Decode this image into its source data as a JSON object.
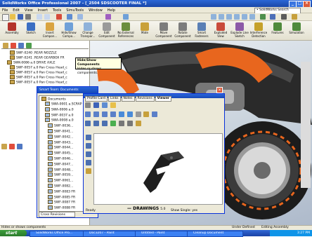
{
  "titlebar": {
    "title": "SolidWorks Office Professional 2007 - [_2504 SDSCOOTER FINAL *]"
  },
  "menu": {
    "items": [
      "File",
      "Edit",
      "View",
      "Insert",
      "Tools",
      "SimuTools",
      "Window",
      "Help"
    ],
    "search_placeholder": "• SolidWorks Search"
  },
  "commands": [
    {
      "label": "Assembly",
      "color": "#b3342c"
    },
    {
      "label": "Sketch",
      "color": "#3c6fc3"
    },
    {
      "label": "Insert Compon...",
      "color": "#d9a441"
    },
    {
      "label": "Hide/Show Compo...",
      "color": "#6fa0d8"
    },
    {
      "label": "Change Transpar...",
      "color": "#8fb2da"
    },
    {
      "label": "Edit Component",
      "color": "#9a9a9a"
    },
    {
      "label": "No External References",
      "color": "#6b8e3d"
    },
    {
      "label": "Mate",
      "color": "#c9a13a"
    },
    {
      "label": "Move Component",
      "color": "#7c7c7c"
    },
    {
      "label": "Rotate Component",
      "color": "#7c7c7c"
    },
    {
      "label": "Smart Fasteners",
      "color": "#5a7fb5"
    },
    {
      "label": "Exploded View",
      "color": "#c94b3b"
    },
    {
      "label": "Explode Line Sketch",
      "color": "#8c5aa8"
    },
    {
      "label": "Interference Detection",
      "color": "#c5a12a"
    },
    {
      "label": "Features",
      "color": "#4f8a3c"
    },
    {
      "label": "Simulation",
      "color": "#4f8a3c"
    }
  ],
  "tooltip": {
    "title": "Hide/Show Components",
    "body": "Hides or shows components."
  },
  "feature_tree": [
    "SWF-0240 .REAR NOZZLE",
    "SWF-0241 .REAR GEARBOX FR",
    "SWK-0086 a.0 DRIVE AXLE",
    "SWF-0057 a.0 Pan Cross Head_c",
    "SWF-0057 a.0 Pan Cross Head_c",
    "SWF-0057 a.0 Pan Cross Head_c",
    "SWF-0057 a.0 Pan Cross Head_c"
  ],
  "doc_window": {
    "title": "Smart Team: Documents",
    "root": "Documents",
    "items": [
      "SWA-0001 a.SCRAP",
      "SWA-0006 a.0",
      "SWF-0037 a.0",
      "SWA-0008 a.0",
      "SWF-0036...",
      "SWF-0041...",
      "SWF-0042...",
      "SWF-0043...",
      "SWF-0044...",
      "SWF-0045...",
      "SWF-0046...",
      "SWF-0047...",
      "SWF-0048...",
      "SWF-0059...",
      "SWF-0061...",
      "SWF-0082...",
      "SWF-0083 FR",
      "SWF-0085 FR",
      "SWF-0087 FR",
      "SWF-0088 FR"
    ],
    "bottom_field": "Cross Revisions"
  },
  "viewer": {
    "tabs": [
      "Profile Card",
      "Links",
      "Notes",
      "Revisions",
      "Viewer"
    ],
    "status": "Ready",
    "logo": "DRAWINGS",
    "logo_mark": "—",
    "version": "5.0",
    "page": "Show Single: yes"
  },
  "statusbar": {
    "left": "Hides or shows components",
    "mid": "Under Defined",
    "right": "Editing Assembly"
  },
  "taskbar": {
    "start": "start",
    "tasks": [
      "SolidWorks Office Pro...",
      "Doc3207 - Paint",
      "Untitled - Paint",
      "Cleanup Document"
    ],
    "clock": "3:27 PM"
  }
}
